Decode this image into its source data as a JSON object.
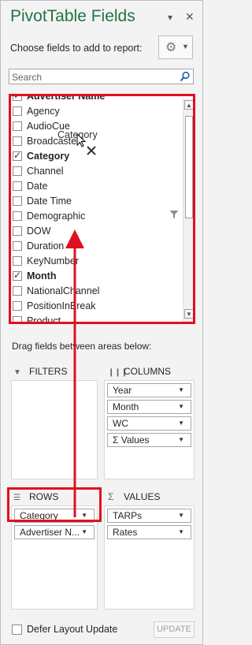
{
  "title": "PivotTable Fields",
  "title_dropdown_glyph": "▾",
  "close_glyph": "✕",
  "hint": "Choose fields to add to report:",
  "search": {
    "placeholder": "Search"
  },
  "fields": [
    {
      "label": "Advertiser Name",
      "checked": true,
      "bold": true,
      "partial": true
    },
    {
      "label": "Agency",
      "checked": false
    },
    {
      "label": "AudioCue",
      "checked": false
    },
    {
      "label": "Broadcaster",
      "checked": false
    },
    {
      "label": "Category",
      "checked": true,
      "bold": true
    },
    {
      "label": "Channel",
      "checked": false
    },
    {
      "label": "Date",
      "checked": false
    },
    {
      "label": "Date Time",
      "checked": false
    },
    {
      "label": "Demographic",
      "checked": false,
      "filtered": true
    },
    {
      "label": "DOW",
      "checked": false
    },
    {
      "label": "Duration",
      "checked": false
    },
    {
      "label": "KeyNumber",
      "checked": false
    },
    {
      "label": "Month",
      "checked": true,
      "bold": true
    },
    {
      "label": "NationalChannel",
      "checked": false
    },
    {
      "label": "PositionInBreak",
      "checked": false
    },
    {
      "label": "Product",
      "checked": false
    }
  ],
  "drag_ghost": "Category",
  "between_label": "Drag fields between areas below:",
  "areas": {
    "filters": {
      "label": "FILTERS",
      "icon": "filter-icon",
      "items": []
    },
    "columns": {
      "label": "COLUMNS",
      "icon": "columns-icon",
      "items": [
        "Year",
        "Month",
        "WC",
        "Σ Values"
      ]
    },
    "rows": {
      "label": "ROWS",
      "icon": "rows-icon",
      "items": [
        "Category",
        "Advertiser N..."
      ]
    },
    "values": {
      "label": "VALUES",
      "icon": "sigma-icon",
      "items": [
        "TARPs",
        "Rates"
      ]
    }
  },
  "footer": {
    "defer_label": "Defer Layout Update",
    "update_label": "UPDATE"
  },
  "colors": {
    "accent": "#217346",
    "highlight": "#e01020"
  }
}
